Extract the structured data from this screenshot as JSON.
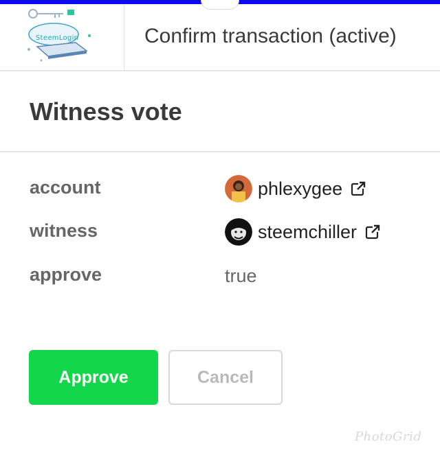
{
  "header": {
    "logo_text": "SteemLogin",
    "title": "Confirm transaction (active)"
  },
  "operation": {
    "title": "Witness vote"
  },
  "fields": [
    {
      "label": "account",
      "value": "phlexygee",
      "type": "account"
    },
    {
      "label": "witness",
      "value": "steemchiller",
      "type": "account"
    },
    {
      "label": "approve",
      "value": "true",
      "type": "text"
    }
  ],
  "actions": {
    "approve_label": "Approve",
    "cancel_label": "Cancel"
  },
  "watermark": "PhotoGrid",
  "colors": {
    "top_bar": "#0b0bf0",
    "approve_button": "#14d64a",
    "logo_accent": "#1aa5b9"
  },
  "icons": {
    "external_link": "external-link-icon"
  }
}
